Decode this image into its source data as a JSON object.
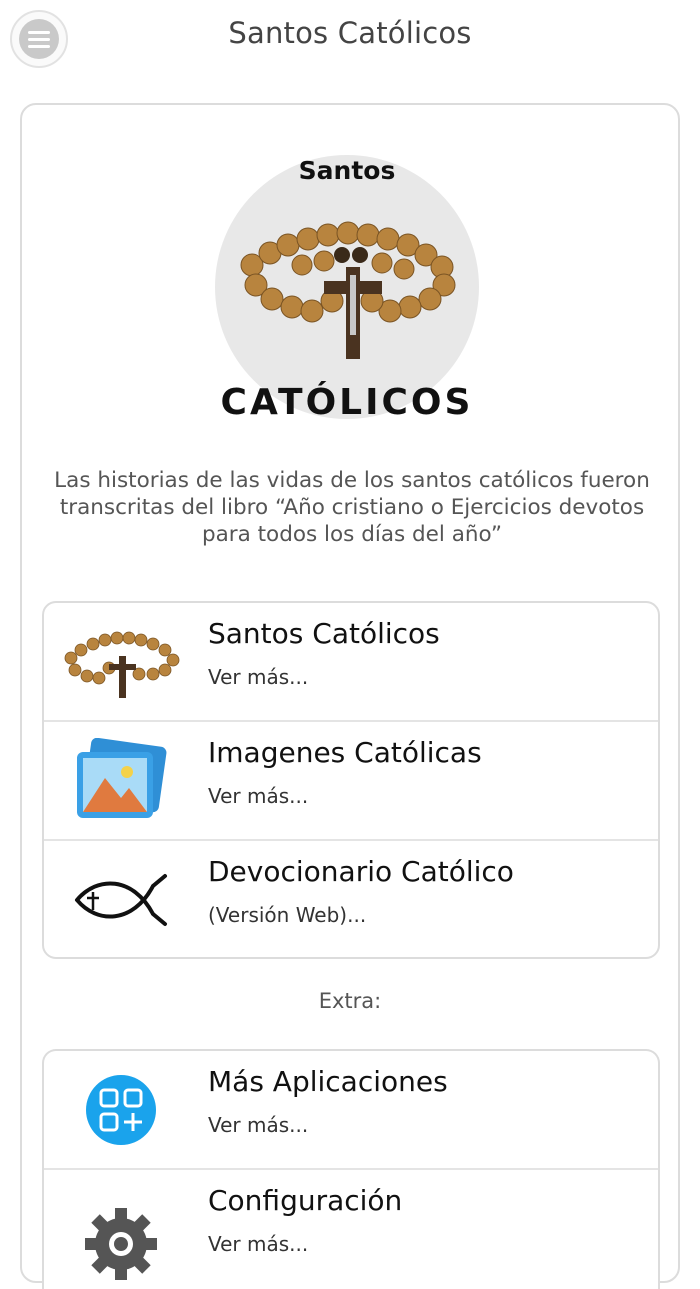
{
  "header": {
    "title": "Santos Católicos",
    "menu_icon": "hamburger-menu-icon"
  },
  "logo": {
    "top_text": "Santos",
    "bottom_text": "CATÓLICOS"
  },
  "description": "Las historias de las vidas de los santos católicos fueron transcritas del libro “Año cristiano o Ejercicios devotos para todos los días del año”",
  "main_list": [
    {
      "title": "Santos Católicos",
      "subtitle": "Ver más...",
      "icon": "rosary-icon"
    },
    {
      "title": "Imagenes Católicas",
      "subtitle": "Ver más...",
      "icon": "picture-icon"
    },
    {
      "title": "Devocionario Católico",
      "subtitle": "(Versión Web)...",
      "icon": "ichthys-fish-icon"
    }
  ],
  "extra_label": "Extra:",
  "extra_list": [
    {
      "title": "Más Aplicaciones",
      "subtitle": "Ver más...",
      "icon": "apps-grid-icon"
    },
    {
      "title": "Configuración",
      "subtitle": "Ver más...",
      "icon": "gear-icon"
    }
  ],
  "colors": {
    "apps_blue": "#1aa3ec",
    "picture_blue": "#2f8fd6",
    "mountain_orange": "#e07a3f",
    "gear_gray": "#555555",
    "bead_brown": "#b8843e"
  }
}
